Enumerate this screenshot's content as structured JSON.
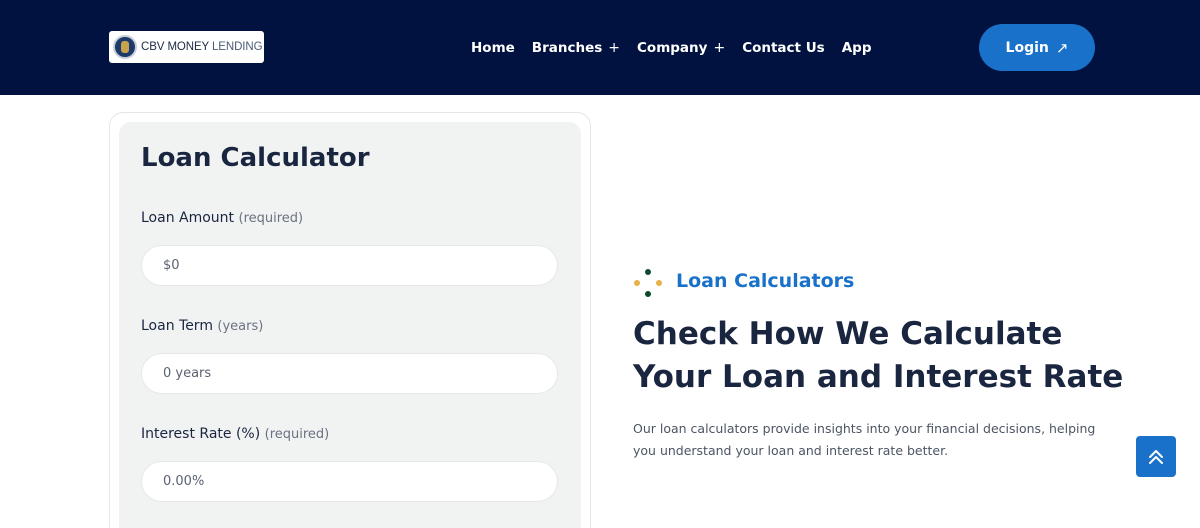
{
  "header": {
    "logo": {
      "text_main": "CBV MONEY",
      "text_light": "LENDING"
    },
    "nav": [
      {
        "label": "Home",
        "has_submenu": false
      },
      {
        "label": "Branches",
        "has_submenu": true
      },
      {
        "label": "Company",
        "has_submenu": true
      },
      {
        "label": "Contact Us",
        "has_submenu": false
      },
      {
        "label": "App",
        "has_submenu": false
      }
    ],
    "login_label": "Login",
    "login_icon": "arrow-up-right-icon"
  },
  "calculator": {
    "title": "Loan Calculator",
    "fields": [
      {
        "label": "Loan Amount",
        "hint": "(required)",
        "placeholder": "$0"
      },
      {
        "label": "Loan Term",
        "hint": "(years)",
        "placeholder": "0 years"
      },
      {
        "label": "Interest Rate (%)",
        "hint": "(required)",
        "placeholder": "0.00%"
      }
    ]
  },
  "info": {
    "badge": "Loan Calculators",
    "headline_line1": "Check How We Calculate",
    "headline_line2": "Your Loan and Interest Rate",
    "description": "Our loan calculators provide insights into your financial decisions, helping you understand your loan and interest rate better."
  },
  "colors": {
    "header_bg": "#011240",
    "accent": "#1a71c9",
    "dot_green": "#0f4a2e",
    "dot_gold": "#e8b04a"
  },
  "scroll_top_icon": "double-chevron-up-icon"
}
